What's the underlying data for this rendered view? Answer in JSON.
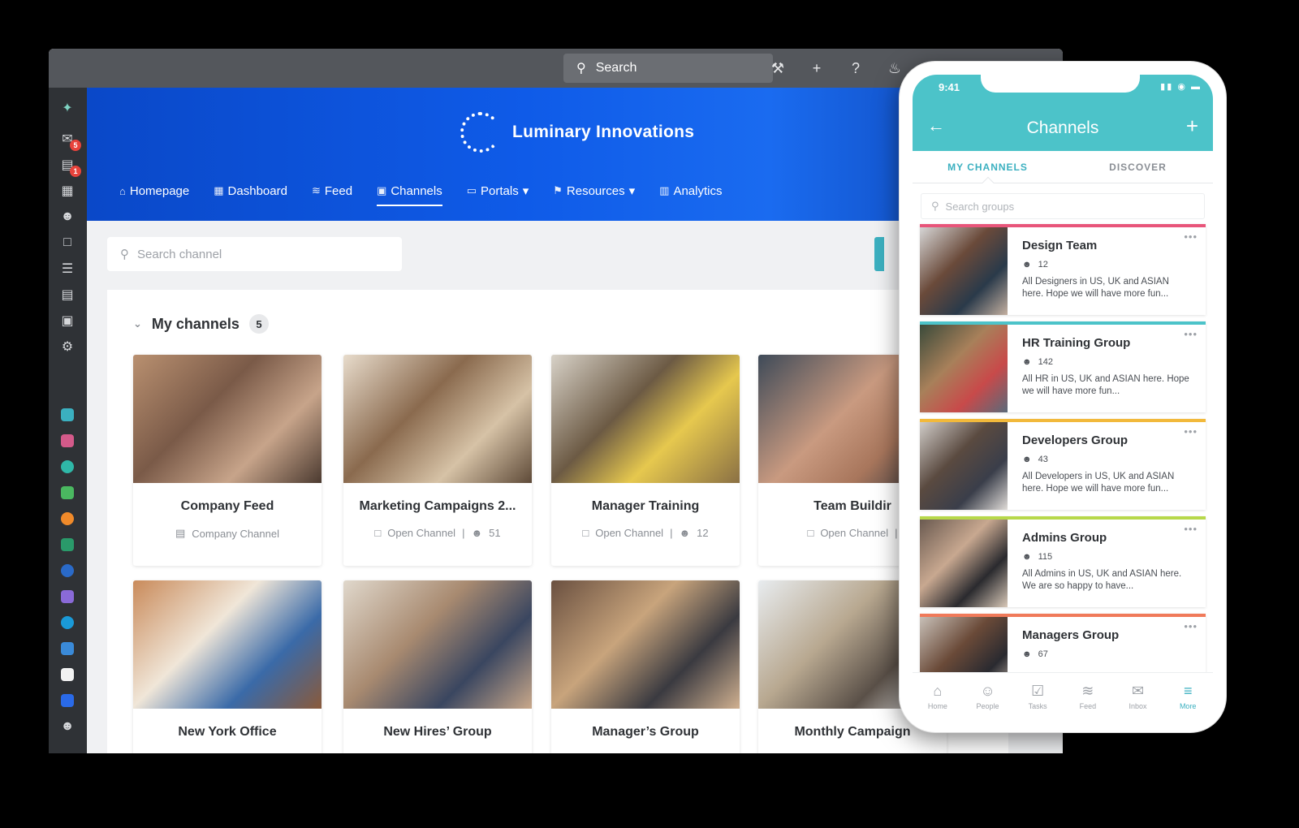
{
  "topbar": {
    "search_label": "Search"
  },
  "brand": {
    "name": "Luminary Innovations"
  },
  "nav": [
    {
      "label": "Homepage",
      "icon": "⌂"
    },
    {
      "label": "Dashboard",
      "icon": "▦"
    },
    {
      "label": "Feed",
      "icon": "≋"
    },
    {
      "label": "Channels",
      "icon": "▣"
    },
    {
      "label": "Portals",
      "icon": "▭"
    },
    {
      "label": "Resources",
      "icon": "⚑"
    },
    {
      "label": "Analytics",
      "icon": "▥"
    }
  ],
  "rail_badges": {
    "inbox": "5",
    "chat": "1"
  },
  "content": {
    "search_placeholder": "Search channel",
    "section_title": "My channels",
    "section_count": "5"
  },
  "cards": [
    {
      "title": "Company Feed",
      "type": "Company Channel",
      "members": ""
    },
    {
      "title": "Marketing Campaigns 2...",
      "type": "Open Channel",
      "members": "51"
    },
    {
      "title": "Manager Training",
      "type": "Open Channel",
      "members": "12"
    },
    {
      "title": "Team Buildir",
      "type": "Open Channel",
      "members": ""
    },
    {
      "title": "New York Office"
    },
    {
      "title": "New Hires’ Group"
    },
    {
      "title": "Manager’s Group"
    },
    {
      "title": "Monthly Campaign"
    }
  ],
  "phone": {
    "time": "9:41",
    "title": "Channels",
    "tabs": [
      "MY CHANNELS",
      "DISCOVER"
    ],
    "search_placeholder": "Search groups",
    "groups": [
      {
        "name": "Design Team",
        "count": "12",
        "desc": "All Designers in US, UK and ASIAN here. Hope we will have more fun...",
        "color": "#e8557a"
      },
      {
        "name": "HR Training Group",
        "count": "142",
        "desc": "All HR in US, UK and ASIAN here. Hope we will have more fun...",
        "color": "#4cc3c9"
      },
      {
        "name": "Developers Group",
        "count": "43",
        "desc": "All Developers in US, UK and ASIAN here. Hope we will have more fun...",
        "color": "#f2b93b"
      },
      {
        "name": "Admins Group",
        "count": "115",
        "desc": "All Admins in US, UK and ASIAN here. We are so happy to have...",
        "color": "#b7d84a"
      },
      {
        "name": "Managers Group",
        "count": "67",
        "desc": "",
        "color": "#f07a5a"
      }
    ],
    "bottom_nav": [
      {
        "label": "Home",
        "icon": "⌂"
      },
      {
        "label": "People",
        "icon": "☺"
      },
      {
        "label": "Tasks",
        "icon": "☑"
      },
      {
        "label": "Feed",
        "icon": "≋"
      },
      {
        "label": "Inbox",
        "icon": "✉"
      },
      {
        "label": "More",
        "icon": "≡"
      }
    ]
  }
}
